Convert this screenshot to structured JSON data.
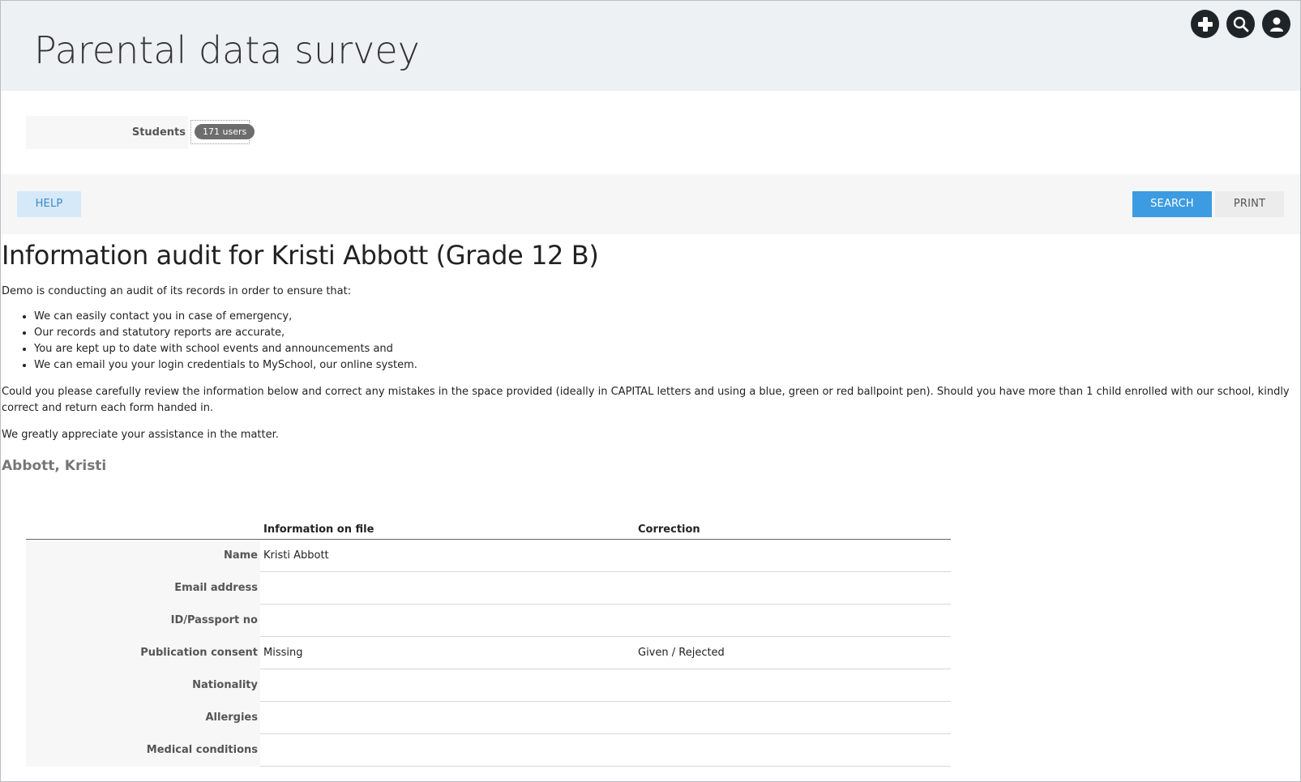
{
  "header": {
    "title": "Parental data survey",
    "icons": [
      "plus-icon",
      "search-icon",
      "user-icon"
    ]
  },
  "filter": {
    "label": "Students",
    "selection": "171 users"
  },
  "toolbar": {
    "help_label": "HELP",
    "search_label": "SEARCH",
    "print_label": "PRINT"
  },
  "content": {
    "heading": "Information audit for Kristi Abbott (Grade 12 B)",
    "intro": "Demo is conducting an audit of its records in order to ensure that:",
    "bullets": [
      "We can easily contact you in case of emergency,",
      "Our records and statutory reports are accurate,",
      "You are kept up to date with school events and announcements and",
      "We can email you your login credentials to MySchool, our online system."
    ],
    "instructions": "Could you please carefully review the information below and correct any mistakes in the space provided (ideally in CAPITAL letters and using a blue, green or red ballpoint pen). Should you have more than 1 child enrolled with our school, kindly correct and return each form handed in.",
    "thanks": "We greatly appreciate your assistance in the matter.",
    "student_name": "Abbott, Kristi"
  },
  "table": {
    "headers": {
      "file": "Information on file",
      "correction": "Correction"
    },
    "rows": [
      {
        "label": "Name",
        "file": "Kristi Abbott",
        "correction": ""
      },
      {
        "label": "Email address",
        "file": "",
        "correction": ""
      },
      {
        "label": "ID/Passport no",
        "file": "",
        "correction": ""
      },
      {
        "label": "Publication consent",
        "file": "Missing",
        "correction": "Given / Rejected"
      },
      {
        "label": "Nationality",
        "file": "",
        "correction": ""
      },
      {
        "label": "Allergies",
        "file": "",
        "correction": ""
      },
      {
        "label": "Medical conditions",
        "file": "",
        "correction": ""
      }
    ]
  },
  "colors": {
    "header_bg": "#edf1f4",
    "accent": "#3d9be1",
    "help_bg": "#d6e9f8",
    "icon_bg": "#1f2428"
  }
}
